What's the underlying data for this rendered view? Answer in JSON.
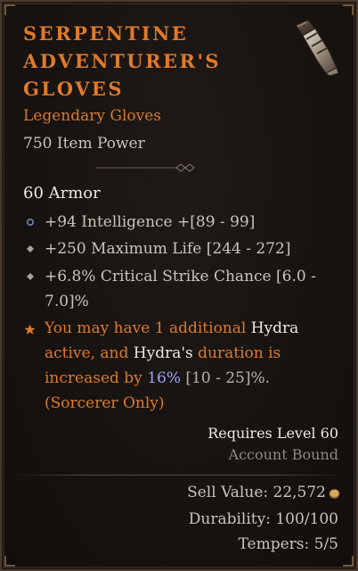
{
  "item": {
    "name_lines": [
      "Serpentine",
      "Adventurer's",
      "Gloves"
    ],
    "rarity_type": "Legendary Gloves",
    "item_power": "750 Item Power",
    "armor": "60 Armor",
    "affixes": [
      {
        "text": "+94 Intelligence +[89 - 99]",
        "icon": "circle-bullet-icon"
      },
      {
        "text": "+250 Maximum Life [244 - 272]",
        "icon": "diamond-bullet-icon"
      },
      {
        "text_lines": [
          "+6.8% Critical Strike Chance [6.0 -",
          "7.0]%"
        ],
        "icon": "diamond-bullet-icon"
      }
    ],
    "aspect": {
      "icon": "star-icon",
      "p1": "You may have 1 additional ",
      "k1": "Hydra",
      "p2": " active, and ",
      "k2": "Hydra's",
      "p3": " duration is increased by ",
      "value": "16%",
      "range": " [10 - 25]%.",
      "p4": " (Sorcerer Only)"
    },
    "requirements": {
      "level": "Requires Level 60",
      "binding": "Account Bound"
    },
    "sell_value": "Sell Value: 22,572",
    "durability": "Durability: 100/100",
    "tempers": "Tempers: 5/5"
  },
  "colors": {
    "legendary": "#e07a2a",
    "text": "#c9c4bc",
    "highlight_white": "#ece8e2",
    "highlight_blue": "#9aa3f2",
    "muted": "#8f8880",
    "background": "#171310",
    "border": "#4a3a2c"
  }
}
